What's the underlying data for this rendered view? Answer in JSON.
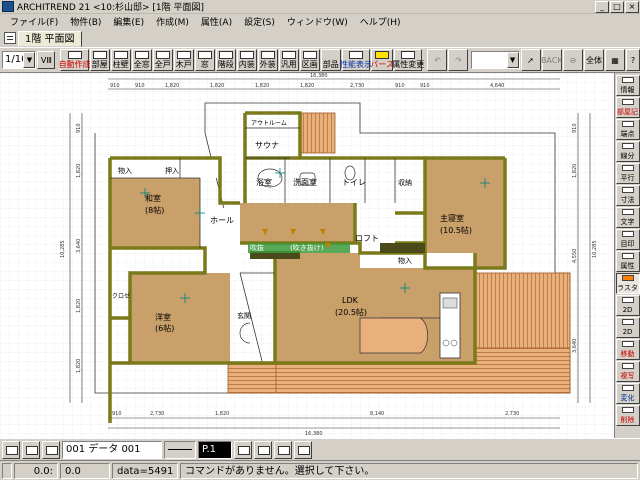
{
  "window": {
    "title": "ARCHITREND 21 <10:杉山邸>  [1階 平面図]",
    "buttons": [
      "_",
      "□",
      "×"
    ]
  },
  "menu": [
    "ファイル(F)",
    "物件(B)",
    "編集(E)",
    "作成(M)",
    "属性(A)",
    "設定(S)",
    "ウィンドウ(W)",
    "ヘルプ(H)"
  ],
  "tab": {
    "label": "1階 平面図"
  },
  "toolbar": {
    "scale": "1/100",
    "view": "VⅢ",
    "buttons": [
      {
        "label": "自動作成",
        "style": "red"
      },
      {
        "label": "部屋",
        "style": "normal"
      },
      {
        "label": "柱壁",
        "style": "normal"
      },
      {
        "label": "全窓",
        "style": "normal"
      },
      {
        "label": "全戸",
        "style": "normal"
      },
      {
        "label": "木戸",
        "style": "normal"
      },
      {
        "label": "窓",
        "style": "normal"
      },
      {
        "label": "階段",
        "style": "normal"
      },
      {
        "label": "内装",
        "style": "normal"
      },
      {
        "label": "外装",
        "style": "normal"
      },
      {
        "label": "汎用",
        "style": "normal"
      },
      {
        "label": "区画",
        "style": "normal"
      },
      {
        "label": "部品",
        "style": "normal"
      },
      {
        "label": "性能表示",
        "style": "blue"
      },
      {
        "label": "パース",
        "style": "red"
      },
      {
        "label": "属性変更",
        "style": "normal"
      }
    ],
    "right_labels": [
      "BACK",
      "全体"
    ]
  },
  "right_panel": [
    {
      "label": "情報",
      "style": "normal"
    },
    {
      "label": "部屋記",
      "style": "red"
    },
    {
      "label": "端点",
      "style": "normal"
    },
    {
      "label": "線分",
      "style": "normal"
    },
    {
      "label": "平行",
      "style": "normal"
    },
    {
      "label": "寸法",
      "style": "normal"
    },
    {
      "label": "文字",
      "style": "normal"
    },
    {
      "label": "目印",
      "style": "normal"
    },
    {
      "label": "属性",
      "style": "normal"
    },
    {
      "label": "ラスタ",
      "style": "active"
    },
    {
      "label": "2D",
      "style": "normal"
    },
    {
      "label": "2D",
      "style": "normal"
    },
    {
      "label": "移動",
      "style": "red"
    },
    {
      "label": "複写",
      "style": "red"
    },
    {
      "label": "変化",
      "style": "blue"
    },
    {
      "label": "削除",
      "style": "red"
    }
  ],
  "plan": {
    "dims_top_total": "16,380",
    "dims_top": [
      "910",
      "910",
      "1,820",
      "1,820",
      "1,820",
      "1,820",
      "2,730",
      "910",
      "910",
      "4,640"
    ],
    "dims_bottom": [
      "910",
      "2,730",
      "1,820",
      "8,140",
      "2,730"
    ],
    "dims_bottom_total": "16,380",
    "dims_left_total": "10,285",
    "dims_left": [
      "910",
      "1,820",
      "3,640",
      "1,820",
      "1,820"
    ],
    "dims_right_total": "10,285",
    "dims_right": [
      "910",
      "1,820",
      "4,550",
      "3,640"
    ],
    "rooms": [
      {
        "name": "アウトルーム"
      },
      {
        "name": "サウナ"
      },
      {
        "name": "浴室"
      },
      {
        "name": "洗面室"
      },
      {
        "name": "トイレ"
      },
      {
        "name": "収納"
      },
      {
        "name": "押入"
      },
      {
        "name": "物入"
      },
      {
        "name": "和室",
        "size": "(8帖)"
      },
      {
        "name": "ホール"
      },
      {
        "name": "吹抜",
        "tag": "(吹き抜け)"
      },
      {
        "name": "ロフト"
      },
      {
        "name": "主寝室",
        "size": "(10.5帖)"
      },
      {
        "name": "物入"
      },
      {
        "name": "クロゼ"
      },
      {
        "name": "洋室",
        "size": "(6帖)"
      },
      {
        "name": "玄関"
      },
      {
        "name": "LDK",
        "size": "(20.5帖)"
      }
    ]
  },
  "bottombar": {
    "layer": "001 データ 001",
    "pen": "P.1"
  },
  "status": {
    "coords": "0.0:",
    "coords_y": "0.0",
    "data": "data=5491",
    "message": "コマンドがありません。選択して下さい。"
  }
}
